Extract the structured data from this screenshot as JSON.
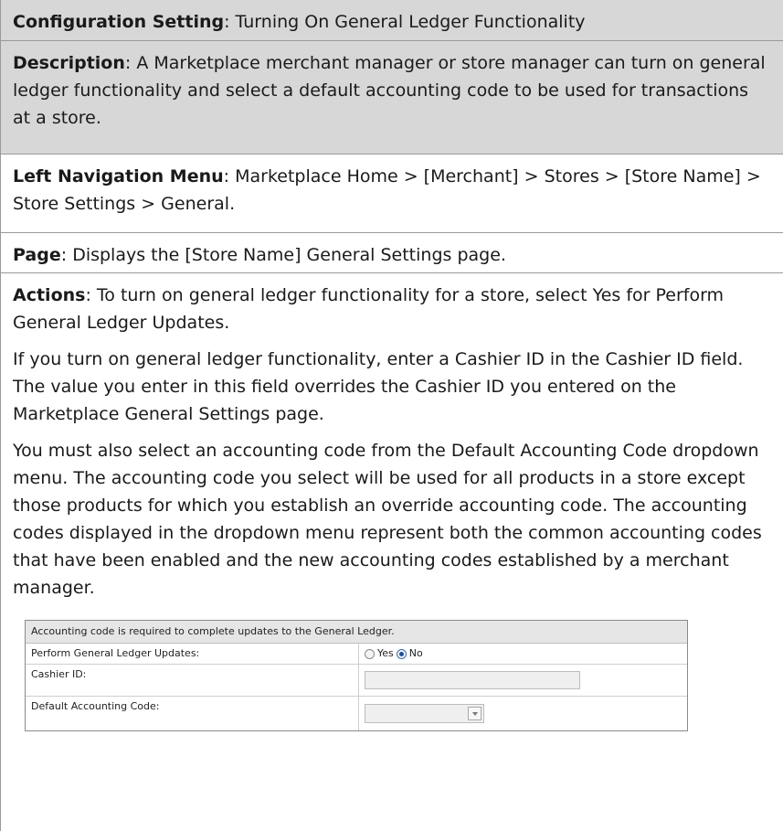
{
  "config": {
    "label": "Configuration Setting",
    "text": "Turning On General Ledger Functionality"
  },
  "description": {
    "label": "Description",
    "text": "A Marketplace merchant manager or store manager can turn on general ledger functionality and select a default accounting code to be used for transactions at a store."
  },
  "left_nav": {
    "label": "Left Navigation Menu",
    "text": "Marketplace Home > [Merchant] > Stores > [Store Name] > Store Settings > General."
  },
  "page": {
    "label": "Page",
    "text": "Displays the [Store Name] General Settings page."
  },
  "actions": {
    "label": "Actions",
    "text": "To turn on general ledger functionality for a store, select Yes for Perform General Ledger Updates.",
    "paragraphs": [
      "If you turn on general ledger functionality, enter a Cashier ID in the Cashier ID field. The value you enter in this field overrides the Cashier ID you entered on the Marketplace General Settings page.",
      "You must also select an accounting code from the Default Accounting Code dropdown menu. The accounting code you select will be used for all products in a store except those products for which you establish an override accounting code. The accounting codes displayed in the dropdown menu represent both the common accounting codes that have been enabled and the new accounting codes established by a merchant manager."
    ]
  },
  "screenshot": {
    "header": "Accounting code is required to complete updates to the General Ledger.",
    "gl_label": "Perform General Ledger Updates:",
    "yes_label": "Yes",
    "no_label": "No",
    "selected": "No",
    "cashier_label": "Cashier ID:",
    "cashier_value": "",
    "accounting_label": "Default Accounting Code:",
    "accounting_value": ""
  }
}
